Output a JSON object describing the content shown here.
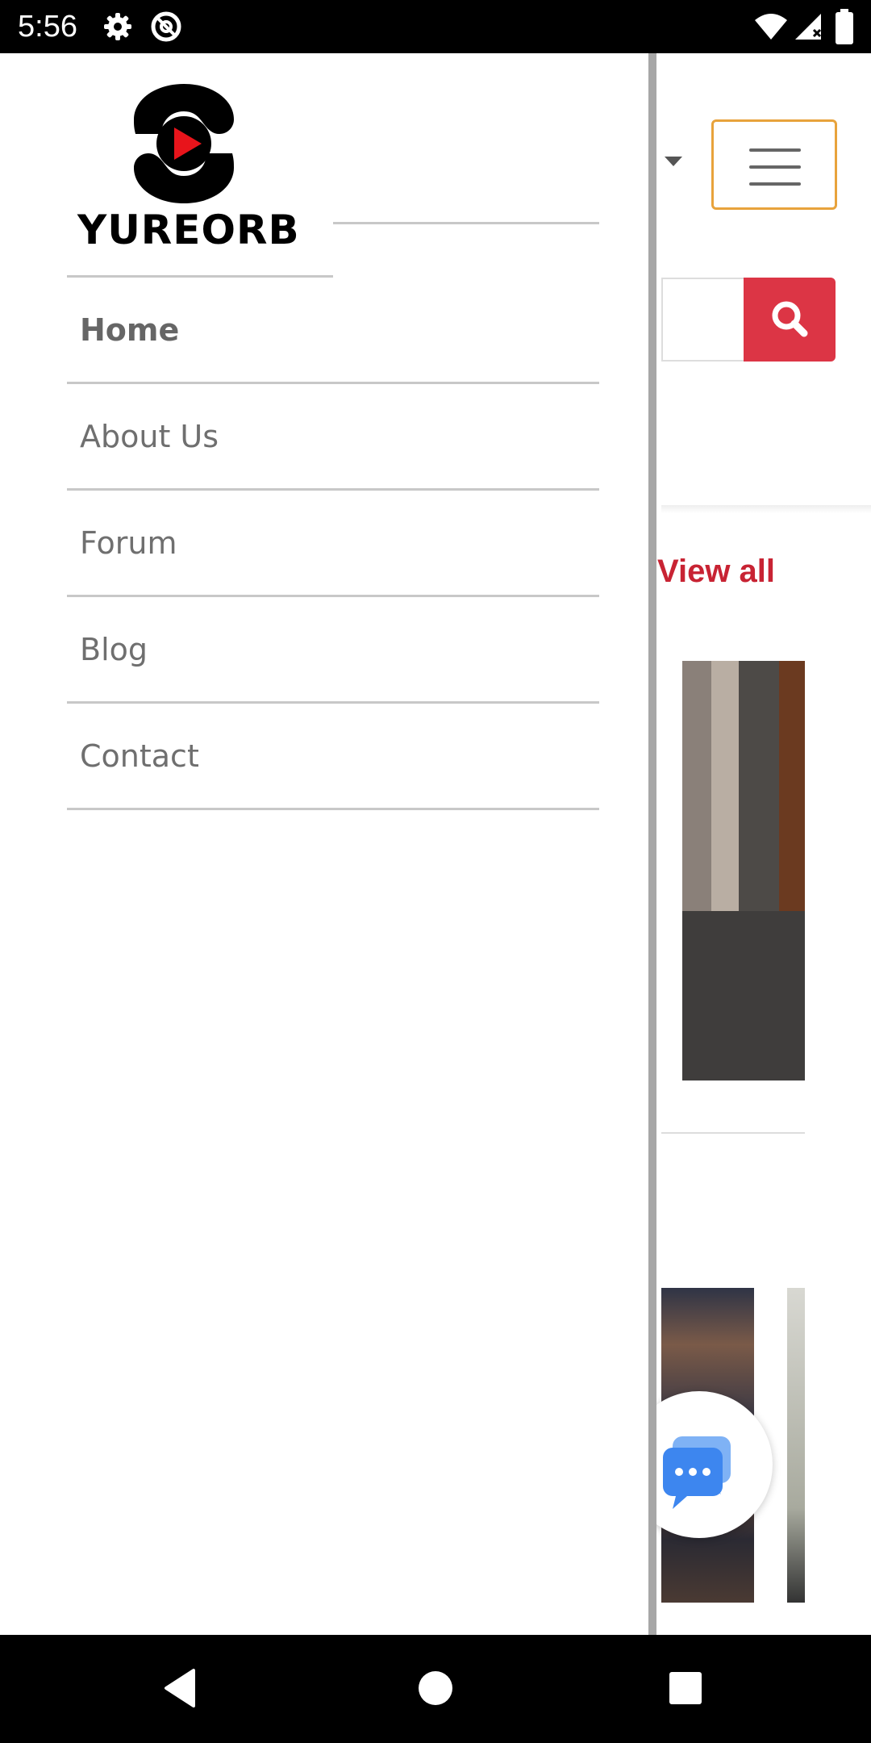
{
  "status_bar": {
    "time": "5:56",
    "icons": [
      "gear-icon",
      "at-sign-icon",
      "wifi-icon",
      "signal-icon",
      "battery-icon"
    ]
  },
  "drawer": {
    "logo_text": "YUREORB",
    "menu": [
      {
        "label": "Home",
        "active": true
      },
      {
        "label": "About Us",
        "active": false
      },
      {
        "label": "Forum",
        "active": false
      },
      {
        "label": "Blog",
        "active": false
      },
      {
        "label": "Contact",
        "active": false
      }
    ]
  },
  "background_page": {
    "view_all_label": "View all",
    "accent_color": "#dc3545",
    "hamburger_border_color": "#e8a33c"
  },
  "navigation_bar": {
    "buttons": [
      "back-icon",
      "home-icon",
      "recents-icon"
    ]
  }
}
